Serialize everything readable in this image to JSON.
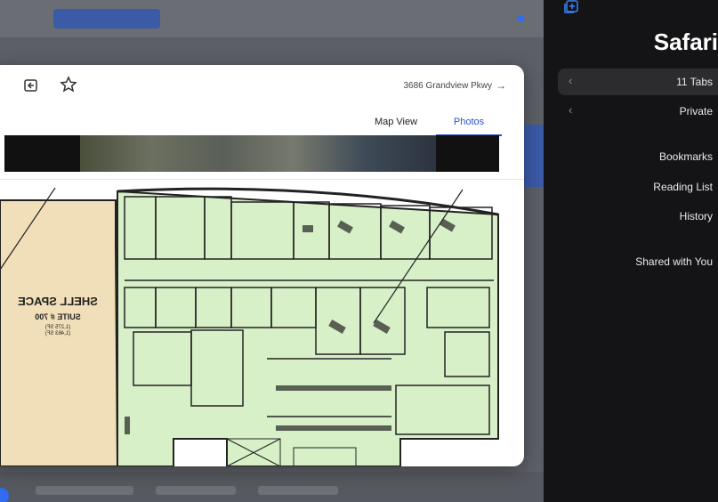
{
  "modal": {
    "address": "3686 Grandview Pkwy",
    "tabs": [
      {
        "label": "Photos",
        "active": true
      },
      {
        "label": "Map View",
        "active": false
      }
    ]
  },
  "floorplan": {
    "shell_title": "SHELL SPACE",
    "suite": "SUITE # 700",
    "area1": "(1,275 SF)",
    "area2": "(1,463 SF)"
  },
  "sidebar": {
    "title": "Safari",
    "items": [
      {
        "label": "11 Tabs",
        "chevron": true,
        "active": true
      },
      {
        "label": "Private",
        "chevron": true,
        "active": false
      },
      {
        "label": "Bookmarks"
      },
      {
        "label": "Reading List"
      },
      {
        "label": "History"
      },
      {
        "label": "Shared with You"
      }
    ]
  },
  "colors": {
    "accent": "#2b55c7",
    "sidebar_bg": "#141416",
    "plan_room": "#d8f0c8",
    "shell": "#f0dfb8"
  }
}
